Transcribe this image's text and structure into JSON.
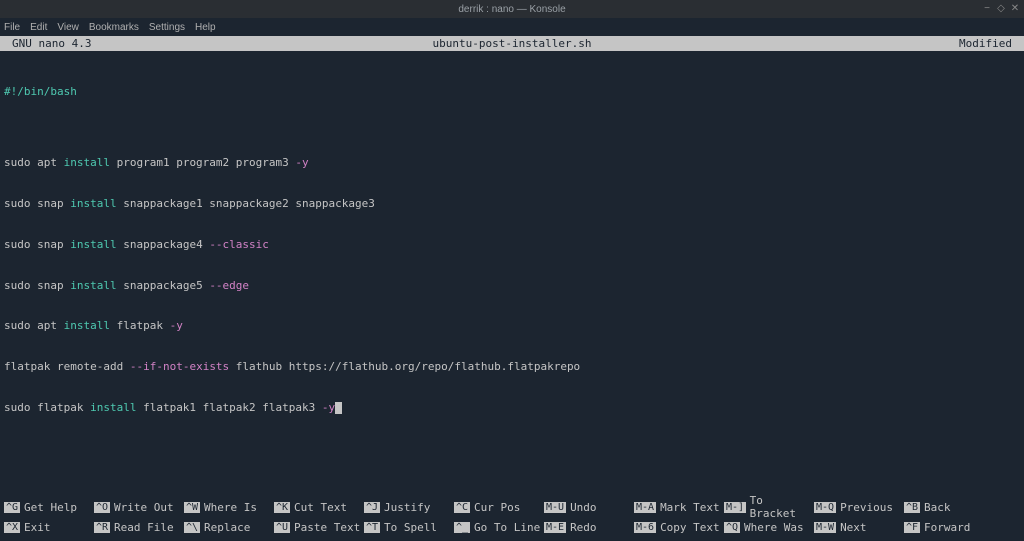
{
  "window": {
    "title": "derrik : nano — Konsole"
  },
  "menubar": {
    "items": [
      "File",
      "Edit",
      "View",
      "Bookmarks",
      "Settings",
      "Help"
    ]
  },
  "nano_header": {
    "version": "GNU nano 4.3",
    "filename": "ubuntu-post-installer.sh",
    "status": "Modified"
  },
  "editor": {
    "shebang": "#!/bin/bash",
    "lines": [
      {
        "pre": "sudo apt ",
        "kw": "install",
        "mid": " program1 program2 program3 ",
        "flag": "-y",
        "post": ""
      },
      {
        "pre": "sudo snap ",
        "kw": "install",
        "mid": " snappackage1 snappackage2 snappackage3",
        "flag": "",
        "post": ""
      },
      {
        "pre": "sudo snap ",
        "kw": "install",
        "mid": " snappackage4 ",
        "flag": "--classic",
        "post": ""
      },
      {
        "pre": "sudo snap ",
        "kw": "install",
        "mid": " snappackage5 ",
        "flag": "--edge",
        "post": ""
      },
      {
        "pre": "sudo apt ",
        "kw": "install",
        "mid": " flatpak ",
        "flag": "-y",
        "post": ""
      },
      {
        "pre": "flatpak remote-add ",
        "kw": "",
        "mid": "",
        "flag": "--if-not-exists",
        "post": " flathub https://flathub.org/repo/flathub.flatpakrepo"
      },
      {
        "pre": "sudo flatpak ",
        "kw": "install",
        "mid": " flatpak1 flatpak2 flatpak3 ",
        "flag": "-y",
        "post": ""
      }
    ]
  },
  "shortcuts_row1": [
    {
      "key": "^G",
      "label": "Get Help"
    },
    {
      "key": "^O",
      "label": "Write Out"
    },
    {
      "key": "^W",
      "label": "Where Is"
    },
    {
      "key": "^K",
      "label": "Cut Text"
    },
    {
      "key": "^J",
      "label": "Justify"
    },
    {
      "key": "^C",
      "label": "Cur Pos"
    },
    {
      "key": "M-U",
      "label": "Undo"
    },
    {
      "key": "M-A",
      "label": "Mark Text"
    },
    {
      "key": "M-]",
      "label": "To Bracket"
    },
    {
      "key": "M-Q",
      "label": "Previous"
    },
    {
      "key": "^B",
      "label": "Back"
    }
  ],
  "shortcuts_row2": [
    {
      "key": "^X",
      "label": "Exit"
    },
    {
      "key": "^R",
      "label": "Read File"
    },
    {
      "key": "^\\",
      "label": "Replace"
    },
    {
      "key": "^U",
      "label": "Paste Text"
    },
    {
      "key": "^T",
      "label": "To Spell"
    },
    {
      "key": "^_",
      "label": "Go To Line"
    },
    {
      "key": "M-E",
      "label": "Redo"
    },
    {
      "key": "M-6",
      "label": "Copy Text"
    },
    {
      "key": "^Q",
      "label": "Where Was"
    },
    {
      "key": "M-W",
      "label": "Next"
    },
    {
      "key": "^F",
      "label": "Forward"
    }
  ]
}
